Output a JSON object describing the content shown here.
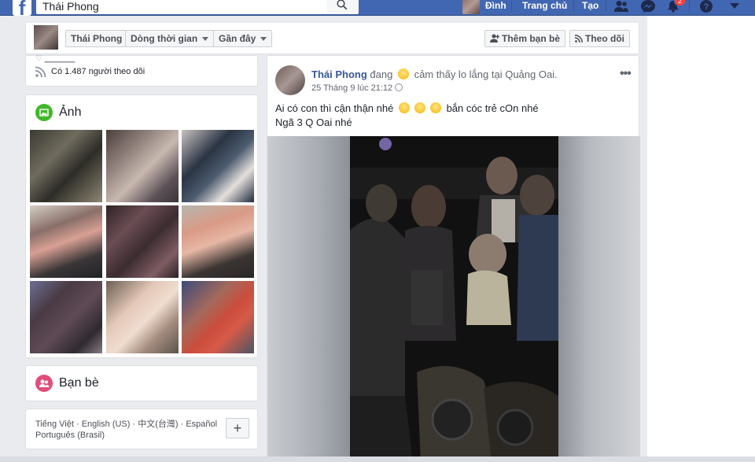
{
  "topbar": {
    "search_value": "Thái Phong",
    "user_name": "Đình",
    "home_label": "Trang chủ",
    "create_label": "Tạo",
    "notification_count": "2"
  },
  "profile_strip": {
    "name_tab": "Thái Phong",
    "timeline_tab": "Dòng thời gian",
    "recent_tab": "Gần đây",
    "add_friend_label": "Thêm bạn bè",
    "follow_label": "Theo dõi"
  },
  "sidebar": {
    "followers_text": "Có 1.487 người theo dõi",
    "photos_title": "Ảnh",
    "friends_title": "Bạn bè",
    "languages_line1": "Tiếng Việt · English (US) · 中文(台灣) · Español",
    "languages_line2": "Português (Brasil)"
  },
  "post": {
    "author": "Thái Phong",
    "action_prefix": "đang",
    "action_suffix": "cảm thấy lo lắng tại",
    "location": "Quảng Oai.",
    "timestamp": "25 Tháng 9 lúc 21:12",
    "text_line1_a": "Ai có con thì cận thận nhé",
    "text_line1_b": "bắn cóc trẻ cOn nhé",
    "text_line2": "Ngã 3 Q Oai nhé"
  },
  "icons": {
    "logo": "facebook-logo",
    "search": "search-icon",
    "friends": "friend-requests-icon",
    "messenger": "messenger-icon",
    "notifications": "notifications-bell-icon",
    "help": "help-icon",
    "menu": "account-menu-caret-icon"
  },
  "colors": {
    "brand_blue": "#4267b2",
    "link_blue": "#365899",
    "badge_red": "#fa3e3e",
    "photos_icon": "#42b72a",
    "friends_icon": "#e04e7b"
  }
}
